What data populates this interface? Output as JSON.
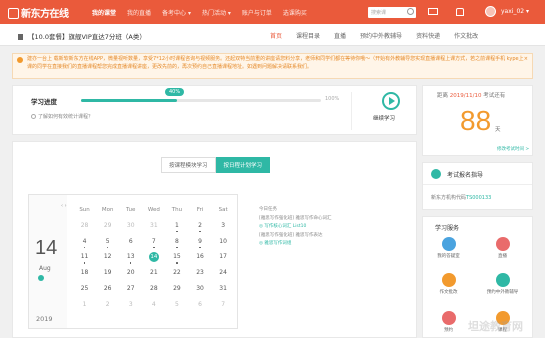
{
  "brand": {
    "logo_text": "新东方在线"
  },
  "topnav": {
    "items": [
      "我的课堂",
      "我的直播",
      "备考中心 ▾",
      "热门活动 ▾",
      "账户与订单",
      "选课购买"
    ],
    "active_index": 0,
    "search_placeholder": "搜索课",
    "username": "yaxi_02 ▾"
  },
  "subheader": {
    "course_title": "【10.0套餐】旗舰VIP直达7分班（A类）",
    "tabs": [
      "首页",
      "课程目录",
      "直播",
      "预约中外教辅导",
      "资料快递",
      "作文批改"
    ],
    "active_index": 0
  },
  "notice": {
    "text": "建亦一台上 载新软新东方在线APP，微量视听数量，享受7*12小时课程咨询与视频服务。还起双特当前重的讲座请您料分享，老师和同学们都在等待你哦～（开始有外教辅导您实现直播课程上课方式，若之前课程手机 kype上课的同学在直接我们的直播课程帮您完成直播课程讲座，更改先前的，再次预约自己直播课程地址。如遇到问题解决请联系我们。",
    "close": "×"
  },
  "progress": {
    "label": "学习进度",
    "percent": 40,
    "percent_text": "40%",
    "max_text": "100%",
    "help_text": "了解如何有效统计课程？",
    "continue_label": "继续学习"
  },
  "exam": {
    "prefix": "距离",
    "date": "2019/11/10",
    "suffix": "考试还有",
    "days": "88",
    "unit": "天",
    "link": "修改考试时间 >"
  },
  "guide": {
    "title": "考试报名指导",
    "sub_prefix": "新东方机构代码",
    "code": "TS000133"
  },
  "services": {
    "title": "学习服务",
    "items": [
      {
        "label": "我的答疑室",
        "color": "#4aa3df"
      },
      {
        "label": "直播",
        "color": "#e96b6b"
      },
      {
        "label": "作文批改",
        "color": "#f29a2e"
      },
      {
        "label": "预约中外教辅导",
        "color": "#2fb8a5"
      },
      {
        "label": "预约",
        "color": "#e96b6b"
      },
      {
        "label": "课程",
        "color": "#f29a2e"
      }
    ]
  },
  "mode_toggle": {
    "options": [
      "按课程模块学习",
      "按日程计划学习"
    ],
    "active_index": 1
  },
  "calendar": {
    "day": "14",
    "month": "Aug",
    "year": "2019",
    "nav": "‹ ›",
    "weekdays": [
      "Sun",
      "Mon",
      "Tue",
      "Wed",
      "Thu",
      "Fri",
      "Sat"
    ],
    "weeks": [
      [
        {
          "d": "28",
          "m": 1
        },
        {
          "d": "29",
          "m": 1
        },
        {
          "d": "30",
          "m": 1
        },
        {
          "d": "31",
          "m": 1
        },
        {
          "d": "1",
          "dot": 1
        },
        {
          "d": "2",
          "dot": 1
        },
        {
          "d": "3"
        }
      ],
      [
        {
          "d": "4",
          "dot": 1
        },
        {
          "d": "5",
          "dot": 1
        },
        {
          "d": "6"
        },
        {
          "d": "7",
          "dot": 1
        },
        {
          "d": "8",
          "dot": 1
        },
        {
          "d": "9",
          "dot": 1
        },
        {
          "d": "10"
        }
      ],
      [
        {
          "d": "11",
          "dot": 1
        },
        {
          "d": "12"
        },
        {
          "d": "13",
          "dot": 1
        },
        {
          "d": "14",
          "today": 1
        },
        {
          "d": "15",
          "dot": 1
        },
        {
          "d": "16"
        },
        {
          "d": "17"
        }
      ],
      [
        {
          "d": "18"
        },
        {
          "d": "19"
        },
        {
          "d": "20"
        },
        {
          "d": "21"
        },
        {
          "d": "22"
        },
        {
          "d": "23"
        },
        {
          "d": "24"
        }
      ],
      [
        {
          "d": "25"
        },
        {
          "d": "26"
        },
        {
          "d": "27"
        },
        {
          "d": "28"
        },
        {
          "d": "29"
        },
        {
          "d": "30"
        },
        {
          "d": "31"
        }
      ],
      [
        {
          "d": "1",
          "m": 1
        },
        {
          "d": "2",
          "m": 1
        },
        {
          "d": "3",
          "m": 1
        },
        {
          "d": "4",
          "m": 1
        },
        {
          "d": "5",
          "m": 1
        },
        {
          "d": "6",
          "m": 1
        },
        {
          "d": "7",
          "m": 1
        }
      ]
    ]
  },
  "tasks": {
    "heading": "今日任务",
    "lines": [
      {
        "text": "[雅思写作强化班] 雅思写作命心词汇",
        "link": false
      },
      {
        "text": "◎ 写作核心词汇 List10",
        "link": true
      },
      {
        "text": "[雅思写作强化班] 雅思写作表达",
        "link": false
      },
      {
        "text": "◎ 雅思写作词组",
        "link": true
      }
    ]
  },
  "watermark": "坦途教育网"
}
